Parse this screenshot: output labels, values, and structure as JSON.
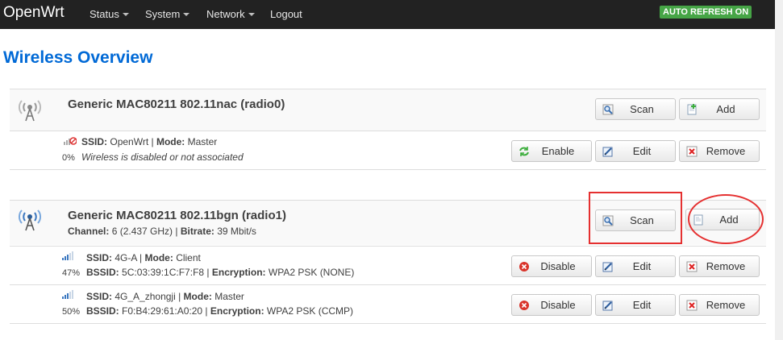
{
  "navbar": {
    "brand": "OpenWrt",
    "menu": [
      {
        "label": "Status",
        "dropdown": true
      },
      {
        "label": "System",
        "dropdown": true
      },
      {
        "label": "Network",
        "dropdown": true
      },
      {
        "label": "Logout",
        "dropdown": false
      }
    ],
    "auto_refresh": "AUTO REFRESH ON"
  },
  "page_title": "Wireless Overview",
  "radios": [
    {
      "name": "Generic MAC80211 802.11nac (radio0)",
      "channel_label": "",
      "channel_value": "",
      "bitrate_label": "",
      "bitrate_value": "",
      "buttons": {
        "scan": "Scan",
        "add": "Add"
      },
      "networks": [
        {
          "ssid_label": "SSID:",
          "ssid": "OpenWrt",
          "mode_label": "Mode:",
          "mode": "Master",
          "status": "Wireless is disabled or not associated",
          "signal": "0%",
          "buttons": {
            "toggle": "Enable",
            "edit": "Edit",
            "remove": "Remove"
          }
        }
      ]
    },
    {
      "name": "Generic MAC80211 802.11bgn (radio1)",
      "channel_label": "Channel:",
      "channel_value": "6 (2.437 GHz)",
      "bitrate_label": "Bitrate:",
      "bitrate_value": "39 Mbit/s",
      "buttons": {
        "scan": "Scan",
        "add": "Add"
      },
      "networks": [
        {
          "ssid_label": "SSID:",
          "ssid": "4G-A",
          "mode_label": "Mode:",
          "mode": "Client",
          "bssid_label": "BSSID:",
          "bssid": "5C:03:39:1C:F7:F8",
          "encryption_label": "Encryption:",
          "encryption": "WPA2 PSK (NONE)",
          "signal": "47%",
          "buttons": {
            "toggle": "Disable",
            "edit": "Edit",
            "remove": "Remove"
          }
        },
        {
          "ssid_label": "SSID:",
          "ssid": "4G_A_zhongji",
          "mode_label": "Mode:",
          "mode": "Master",
          "bssid_label": "BSSID:",
          "bssid": "F0:B4:29:61:A0:20",
          "encryption_label": "Encryption:",
          "encryption": "WPA2 PSK (CCMP)",
          "signal": "50%",
          "buttons": {
            "toggle": "Disable",
            "edit": "Edit",
            "remove": "Remove"
          }
        }
      ]
    }
  ],
  "colors": {
    "navbar_bg": "#222222",
    "auto_refresh_bg": "#46a546",
    "title": "#0069d6",
    "annotation": "#e53030"
  }
}
